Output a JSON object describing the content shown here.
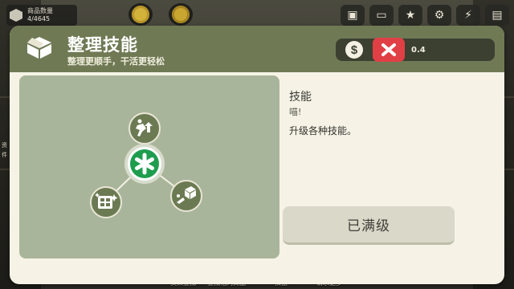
{
  "hud": {
    "item_count_label": "商品数量",
    "item_count_value": "4/4645",
    "bottom_buttons": [
      "货架查找",
      "查找相同商品",
      "扣篮",
      "请求更多"
    ],
    "pickup_label": "拿起",
    "side_text_left_1": "资",
    "side_text_left_2": "件"
  },
  "dialog": {
    "title": "整理技能",
    "subtitle": "整理更顺手，干活更轻松",
    "currency_symbol": "$",
    "currency_value": "0.4",
    "skill": {
      "title": "技能",
      "subtitle": "喵!",
      "description": "升级各种技能。",
      "maxed_label": "已满级"
    }
  },
  "icons": {
    "header": "box-icon",
    "currency": "dollar-icon",
    "close": "close-x-icon",
    "center_node": "asterisk-icon",
    "node_top": "running-boost-icon",
    "node_left": "cabinet-sparkle-icon",
    "node_right": "toss-box-icon"
  },
  "colors": {
    "header_bg": "#6f7a55",
    "panel_bg": "#a9b59a",
    "close_red": "#e04045",
    "node_green": "#6b7a52",
    "center_green": "#1f9d4e"
  }
}
